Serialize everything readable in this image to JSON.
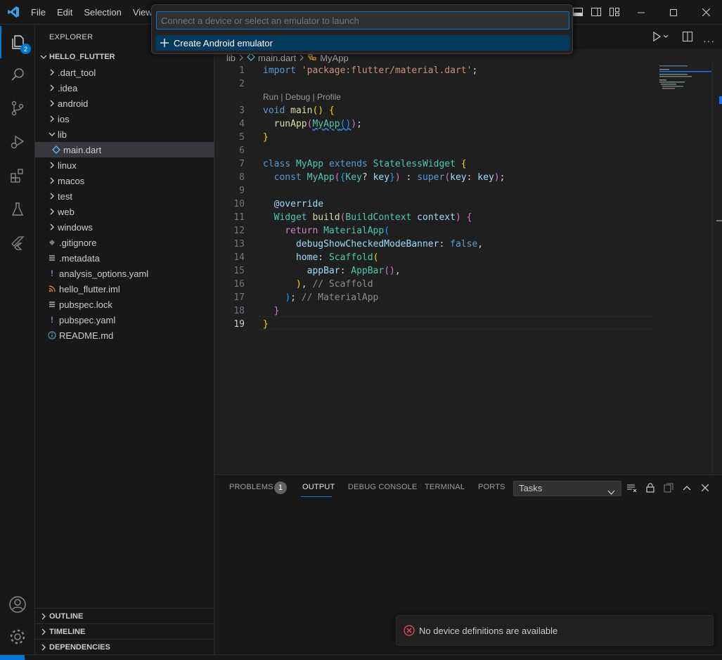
{
  "titlebar": {
    "menu": [
      "File",
      "Edit",
      "Selection",
      "View"
    ]
  },
  "activity": {
    "explorer_badge": "2"
  },
  "sidebar": {
    "title": "EXPLORER",
    "root": "HELLO_FLUTTER",
    "items": [
      {
        "label": ".dart_tool",
        "kind": "folder"
      },
      {
        "label": ".idea",
        "kind": "folder"
      },
      {
        "label": "android",
        "kind": "folder"
      },
      {
        "label": "ios",
        "kind": "folder"
      },
      {
        "label": "lib",
        "kind": "folder-open"
      },
      {
        "label": "main.dart",
        "kind": "dart"
      },
      {
        "label": "linux",
        "kind": "folder"
      },
      {
        "label": "macos",
        "kind": "folder"
      },
      {
        "label": "test",
        "kind": "folder"
      },
      {
        "label": "web",
        "kind": "folder"
      },
      {
        "label": "windows",
        "kind": "folder"
      },
      {
        "label": ".gitignore",
        "kind": "git"
      },
      {
        "label": ".metadata",
        "kind": "lines"
      },
      {
        "label": "analysis_options.yaml",
        "kind": "yaml"
      },
      {
        "label": "hello_flutter.iml",
        "kind": "rss"
      },
      {
        "label": "pubspec.lock",
        "kind": "lines"
      },
      {
        "label": "pubspec.yaml",
        "kind": "yaml"
      },
      {
        "label": "README.md",
        "kind": "info"
      }
    ],
    "sections": [
      "OUTLINE",
      "TIMELINE",
      "DEPENDENCIES"
    ]
  },
  "palette": {
    "placeholder": "Connect a device or select an emulator to launch",
    "item": "Create Android emulator"
  },
  "editor": {
    "breadcrumb": [
      "lib",
      "main.dart",
      "MyApp"
    ],
    "codelens": "Run | Debug | Profile",
    "line_numbers": [
      "1",
      "2",
      "3",
      "4",
      "5",
      "6",
      "7",
      "8",
      "9",
      "10",
      "11",
      "12",
      "13",
      "14",
      "15",
      "16",
      "17",
      "18",
      "19"
    ]
  },
  "panel": {
    "tabs": [
      "PROBLEMS",
      "OUTPUT",
      "DEBUG CONSOLE",
      "TERMINAL",
      "PORTS"
    ],
    "problems_count": "1",
    "select_value": "Tasks"
  },
  "notification": {
    "message": "No device definitions are available"
  },
  "colors": {
    "accent": "#0078d4",
    "error": "#f14c4c",
    "flutter": "#54c5f8"
  }
}
